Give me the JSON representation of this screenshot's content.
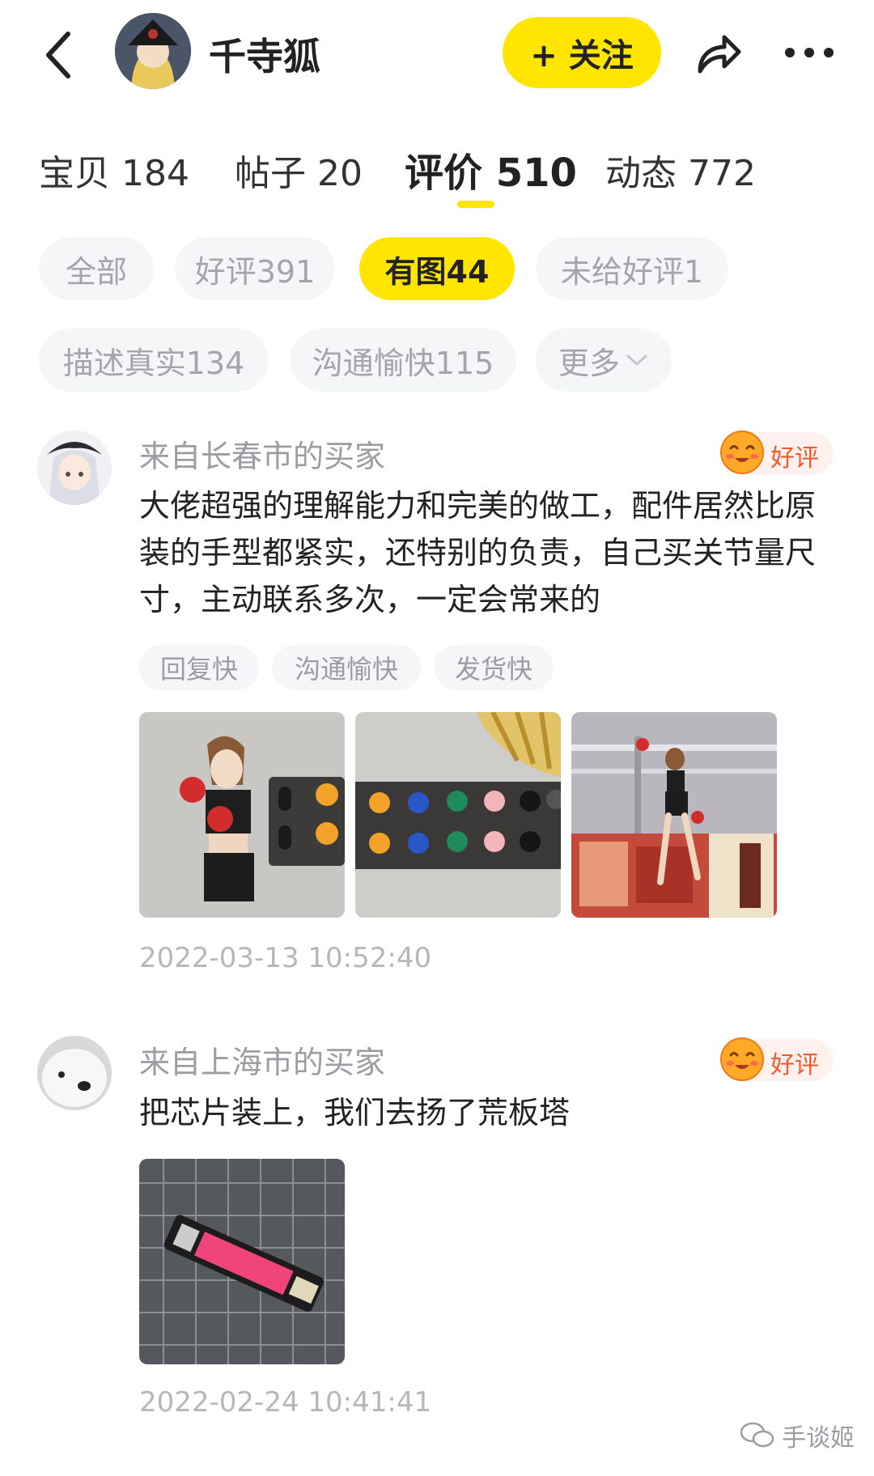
{
  "header": {
    "seller_name": "千寺狐",
    "follow_label": "+ 关注"
  },
  "tabs": [
    {
      "label": "宝贝 184"
    },
    {
      "label": "帖子 20"
    },
    {
      "label": "评价 510"
    },
    {
      "label": "动态 772"
    }
  ],
  "filters": [
    {
      "label": "全部"
    },
    {
      "label": "好评391"
    },
    {
      "label": "有图44"
    },
    {
      "label": "未给好评1"
    },
    {
      "label": "描述真实134"
    },
    {
      "label": "沟通愉快115"
    },
    {
      "label": "更多"
    }
  ],
  "reviews": [
    {
      "buyer": "来自长春市的买家",
      "badge": "好评",
      "text": "大佬超强的理解能力和完美的做工，配件居然比原装的手型都紧实，还特别的负责，自己买关节量尺寸，主动联系多次，一定会常来的",
      "tags": [
        "回复快",
        "沟通愉快",
        "发货快"
      ],
      "time": "2022-03-13 10:52:40"
    },
    {
      "buyer": "来自上海市的买家",
      "badge": "好评",
      "text": "把芯片装上，我们去扬了荒板塔",
      "time": "2022-02-24 10:41:41"
    }
  ],
  "watermark": "手谈姬",
  "colors": {
    "accent": "#ffe500",
    "good_badge": "#f25a2e"
  }
}
